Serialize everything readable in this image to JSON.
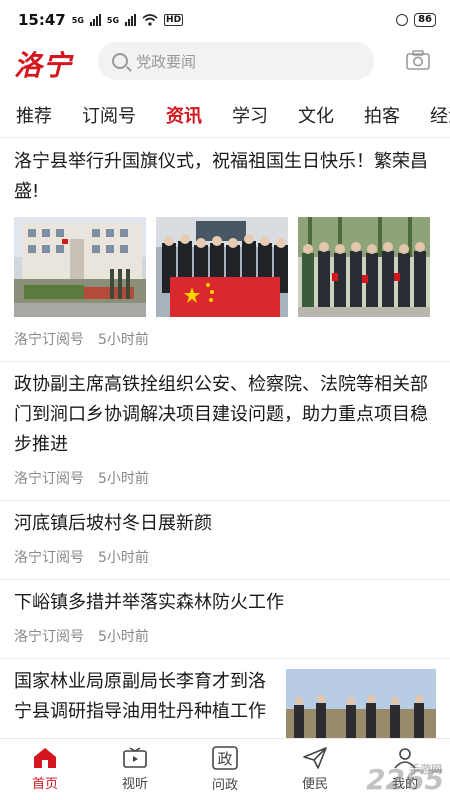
{
  "status_bar": {
    "time": "15:47",
    "network_1": "5G",
    "network_2": "5G",
    "hd": "HD",
    "battery": "86"
  },
  "header": {
    "logo": "洛宁",
    "search_placeholder": "党政要闻"
  },
  "tabs": [
    {
      "label": "推荐"
    },
    {
      "label": "订阅号"
    },
    {
      "label": "资讯"
    },
    {
      "label": "学习"
    },
    {
      "label": "文化"
    },
    {
      "label": "拍客"
    },
    {
      "label": "经济"
    }
  ],
  "feed": [
    {
      "title": "洛宁县举行升国旗仪式，祝福祖国生日快乐！繁荣昌盛!",
      "source": "洛宁订阅号",
      "time": "5小时前"
    },
    {
      "title": "政协副主席高铁拴组织公安、检察院、法院等相关部门到涧口乡协调解决项目建设问题，助力重点项目稳步推进",
      "source": "洛宁订阅号",
      "time": "5小时前"
    },
    {
      "title": "河底镇后坡村冬日展新颜",
      "source": "洛宁订阅号",
      "time": "5小时前"
    },
    {
      "title": "下峪镇多措并举落实森林防火工作",
      "source": "洛宁订阅号",
      "time": "5小时前"
    },
    {
      "title": "国家林业局原副局长李育才到洛宁县调研指导油用牡丹种植工作"
    }
  ],
  "bottom_nav": [
    {
      "label": "首页",
      "icon": "home-icon"
    },
    {
      "label": "视听",
      "icon": "tv-icon"
    },
    {
      "label": "问政",
      "icon": "zheng-icon"
    },
    {
      "label": "便民",
      "icon": "send-icon"
    },
    {
      "label": "我的",
      "icon": "user-icon"
    }
  ],
  "watermark": {
    "brand": "2265",
    "sub": "手游网"
  },
  "colors": {
    "accent": "#d4161e",
    "divider": "#ececec"
  }
}
